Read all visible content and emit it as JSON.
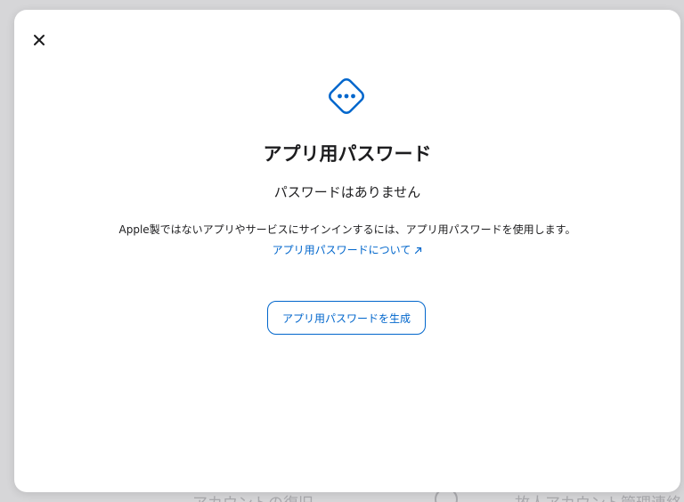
{
  "background": {
    "left_hint": "アカウントの復旧",
    "right_hint": "故人アカウント管理連絡"
  },
  "modal": {
    "close_icon": "close-icon",
    "app_icon": "ellipsis-diamond-icon",
    "title": "アプリ用パスワード",
    "subtitle": "パスワードはありません",
    "description": "Apple製ではないアプリやサービスにサインインするには、アプリ用パスワードを使用します。",
    "learn_more_label": "アプリ用パスワードについて",
    "learn_more_icon": "external-arrow-icon",
    "generate_button_label": "アプリ用パスワードを生成"
  },
  "colors": {
    "accent": "#0066cc",
    "text": "#1d1d1f",
    "backdrop": "#d6d6d8",
    "modal_bg": "#ffffff"
  }
}
